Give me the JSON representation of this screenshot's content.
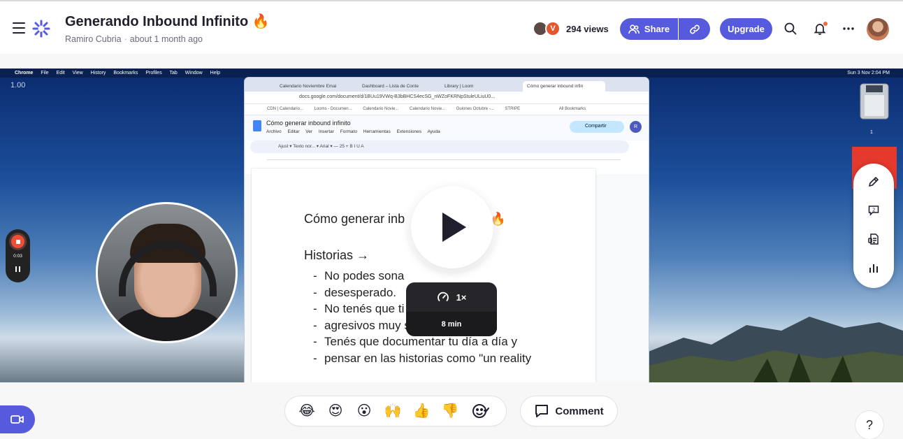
{
  "header": {
    "title": "Generando Inbound Infinito 🔥",
    "author": "Ramiro Cubria",
    "separator": "·",
    "date": "about 1 month ago",
    "viewer_initial": "V",
    "views": "294 views",
    "share_label": "Share",
    "upgrade_label": "Upgrade"
  },
  "video": {
    "speed_tag": "1.00",
    "mac_menu": [
      "Chrome",
      "File",
      "Edit",
      "View",
      "History",
      "Bookmarks",
      "Profiles",
      "Tab",
      "Window",
      "Help"
    ],
    "mac_clock": "Sun 3 Nov  2:04 PM",
    "recorder_time": "0:03",
    "sd_count": "1",
    "speed_value": "1×",
    "duration": "8 min"
  },
  "browser": {
    "tabs": [
      "Calendario Noviembre Emai",
      "Dashboard – Lista de Conte",
      "Library | Loom",
      "Cómo generar inbound infin"
    ],
    "url": "docs.google.com/document/d/1BUu19VWq-B3bBHCS4ecSG_nWZoFKRNpStuleULiuU0...",
    "bookmarks": [
      "CDN | Calendario...",
      "Looms - Documen...",
      "Calendario Novie...",
      "Calendario Novie...",
      "Guiones Octubre -...",
      "STRIPE",
      "All Bookmarks"
    ],
    "doc_title": "Cómo generar inbound infinito",
    "doc_menu": [
      "Archivo",
      "Editar",
      "Ver",
      "Insertar",
      "Formato",
      "Herramientas",
      "Extensiones",
      "Ayuda"
    ],
    "share_label": "Compartir",
    "avatar_initial": "R",
    "toolbar": "Ajust ▾    Texto nor... ▾    Arial ▾    —  25  +    B  I  U  A"
  },
  "doc": {
    "heading_visible": "Cómo generar inb",
    "heading_emoji": "🔥",
    "section": "Historias →",
    "bullets": [
      "No podes sona",
      "desesperado.",
      "No tenés que ti                     ta",
      "agresivos muy seguido.",
      "Tenés que documentar tu día a día y",
      "pensar en las historias como \"un reality"
    ]
  },
  "reactions": [
    "😂",
    "😍",
    "😮",
    "🙌",
    "👍",
    "👎"
  ],
  "comment_label": "Comment",
  "help_label": "?",
  "colors": {
    "brand": "#565add",
    "record_red": "#f04f37",
    "notification": "#f26b3a"
  }
}
